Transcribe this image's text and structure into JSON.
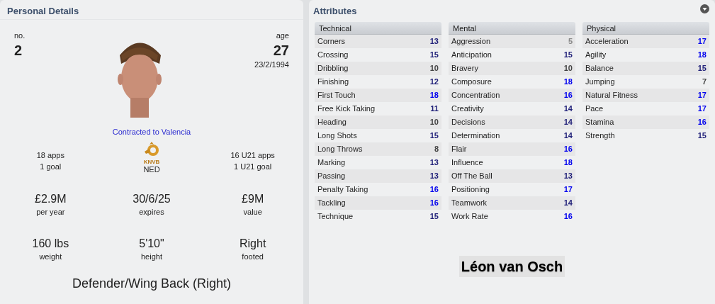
{
  "personal": {
    "title": "Personal Details",
    "number_label": "no.",
    "number": "2",
    "age_label": "age",
    "age": "27",
    "dob": "23/2/1994",
    "photo": {
      "kind": "picture"
    },
    "contract": "Contracted to Valencia",
    "apps": [
      "18 apps",
      "1 goal"
    ],
    "nation": {
      "badge_text": "KNVB",
      "code": "NED"
    },
    "u21": [
      "16 U21 apps",
      "1 U21 goal"
    ],
    "facts": [
      {
        "value": "£2.9M",
        "label": "per year"
      },
      {
        "value": "30/6/25",
        "label": "expires"
      },
      {
        "value": "£9M",
        "label": "value"
      },
      {
        "value": "160 lbs",
        "label": "weight"
      },
      {
        "value": "5'10\"",
        "label": "height"
      },
      {
        "value": "Right",
        "label": "footed"
      }
    ],
    "position": "Defender/Wing Back (Right)"
  },
  "attributes": {
    "title": "Attributes",
    "groups": [
      {
        "name": "Technical",
        "items": [
          {
            "name": "Corners",
            "value": "13",
            "color": "#22227a"
          },
          {
            "name": "Crossing",
            "value": "15",
            "color": "#22227a"
          },
          {
            "name": "Dribbling",
            "value": "10",
            "color": "#444444"
          },
          {
            "name": "Finishing",
            "value": "12",
            "color": "#22227a"
          },
          {
            "name": "First Touch",
            "value": "18",
            "color": "#0000ee"
          },
          {
            "name": "Free Kick Taking",
            "value": "11",
            "color": "#22227a"
          },
          {
            "name": "Heading",
            "value": "10",
            "color": "#444444"
          },
          {
            "name": "Long Shots",
            "value": "15",
            "color": "#22227a"
          },
          {
            "name": "Long Throws",
            "value": "8",
            "color": "#444444"
          },
          {
            "name": "Marking",
            "value": "13",
            "color": "#22227a"
          },
          {
            "name": "Passing",
            "value": "13",
            "color": "#22227a"
          },
          {
            "name": "Penalty Taking",
            "value": "16",
            "color": "#0000ee"
          },
          {
            "name": "Tackling",
            "value": "16",
            "color": "#0000ee"
          },
          {
            "name": "Technique",
            "value": "15",
            "color": "#22227a"
          }
        ]
      },
      {
        "name": "Mental",
        "items": [
          {
            "name": "Aggression",
            "value": "5",
            "color": "#888888"
          },
          {
            "name": "Anticipation",
            "value": "15",
            "color": "#22227a"
          },
          {
            "name": "Bravery",
            "value": "10",
            "color": "#444444"
          },
          {
            "name": "Composure",
            "value": "18",
            "color": "#0000ee"
          },
          {
            "name": "Concentration",
            "value": "16",
            "color": "#0000ee"
          },
          {
            "name": "Creativity",
            "value": "14",
            "color": "#22227a"
          },
          {
            "name": "Decisions",
            "value": "14",
            "color": "#22227a"
          },
          {
            "name": "Determination",
            "value": "14",
            "color": "#22227a"
          },
          {
            "name": "Flair",
            "value": "16",
            "color": "#0000ee"
          },
          {
            "name": "Influence",
            "value": "18",
            "color": "#0000ee"
          },
          {
            "name": "Off The Ball",
            "value": "13",
            "color": "#22227a"
          },
          {
            "name": "Positioning",
            "value": "17",
            "color": "#0000ee"
          },
          {
            "name": "Teamwork",
            "value": "14",
            "color": "#22227a"
          },
          {
            "name": "Work Rate",
            "value": "16",
            "color": "#0000ee"
          }
        ]
      },
      {
        "name": "Physical",
        "items": [
          {
            "name": "Acceleration",
            "value": "17",
            "color": "#0000ee"
          },
          {
            "name": "Agility",
            "value": "18",
            "color": "#0000ee"
          },
          {
            "name": "Balance",
            "value": "15",
            "color": "#22227a"
          },
          {
            "name": "Jumping",
            "value": "7",
            "color": "#444444"
          },
          {
            "name": "Natural Fitness",
            "value": "17",
            "color": "#0000ee"
          },
          {
            "name": "Pace",
            "value": "17",
            "color": "#0000ee"
          },
          {
            "name": "Stamina",
            "value": "16",
            "color": "#0000ee"
          },
          {
            "name": "Strength",
            "value": "15",
            "color": "#22227a"
          }
        ]
      }
    ],
    "player_name": "Léon van Osch"
  }
}
